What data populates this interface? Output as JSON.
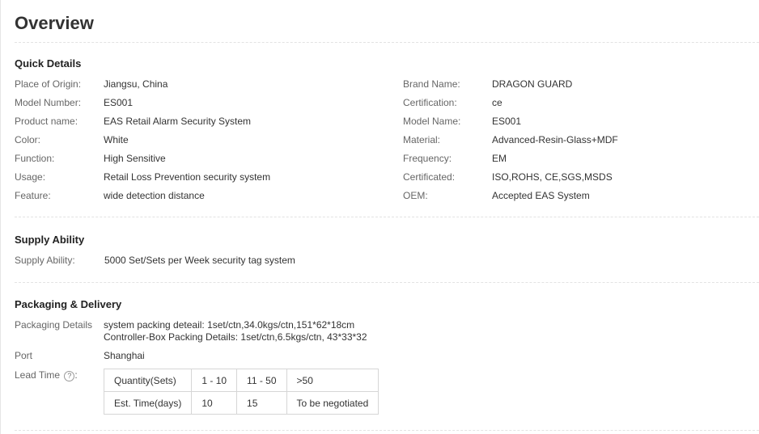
{
  "title": "Overview",
  "quick_details": {
    "heading": "Quick Details",
    "left": [
      {
        "label": "Place of Origin:",
        "value": "Jiangsu, China"
      },
      {
        "label": "Model Number:",
        "value": "ES001"
      },
      {
        "label": "Product name:",
        "value": "EAS Retail Alarm Security System"
      },
      {
        "label": "Color:",
        "value": "White"
      },
      {
        "label": "Function:",
        "value": "High Sensitive"
      },
      {
        "label": "Usage:",
        "value": "Retail Loss Prevention security system"
      },
      {
        "label": "Feature:",
        "value": "wide detection distance"
      }
    ],
    "right": [
      {
        "label": "Brand Name:",
        "value": "DRAGON GUARD"
      },
      {
        "label": "Certification:",
        "value": "ce"
      },
      {
        "label": "Model Name:",
        "value": "ES001"
      },
      {
        "label": "Material:",
        "value": "Advanced-Resin-Glass+MDF"
      },
      {
        "label": "Frequency:",
        "value": "EM"
      },
      {
        "label": "Certificated:",
        "value": "ISO,ROHS, CE,SGS,MSDS"
      },
      {
        "label": "OEM:",
        "value": "Accepted EAS System"
      }
    ]
  },
  "supply_ability": {
    "heading": "Supply Ability",
    "label": "Supply Ability:",
    "value": "5000 Set/Sets per Week security tag system"
  },
  "packaging": {
    "heading": "Packaging & Delivery",
    "details_label": "Packaging Details",
    "details_line1": "system packing deteail: 1set/ctn,34.0kgs/ctn,151*62*18cm",
    "details_line2": "Controller-Box Packing Details: 1set/ctn,6.5kgs/ctn, 43*33*32",
    "port_label": "Port",
    "port_value": "Shanghai",
    "lead_label": "Lead Time",
    "lead_icon": "?",
    "lead_colon": ":",
    "lead_table": {
      "row1": [
        "Quantity(Sets)",
        "1 - 10",
        "11 - 50",
        ">50"
      ],
      "row2": [
        "Est. Time(days)",
        "10",
        "15",
        "To be negotiated"
      ]
    }
  }
}
